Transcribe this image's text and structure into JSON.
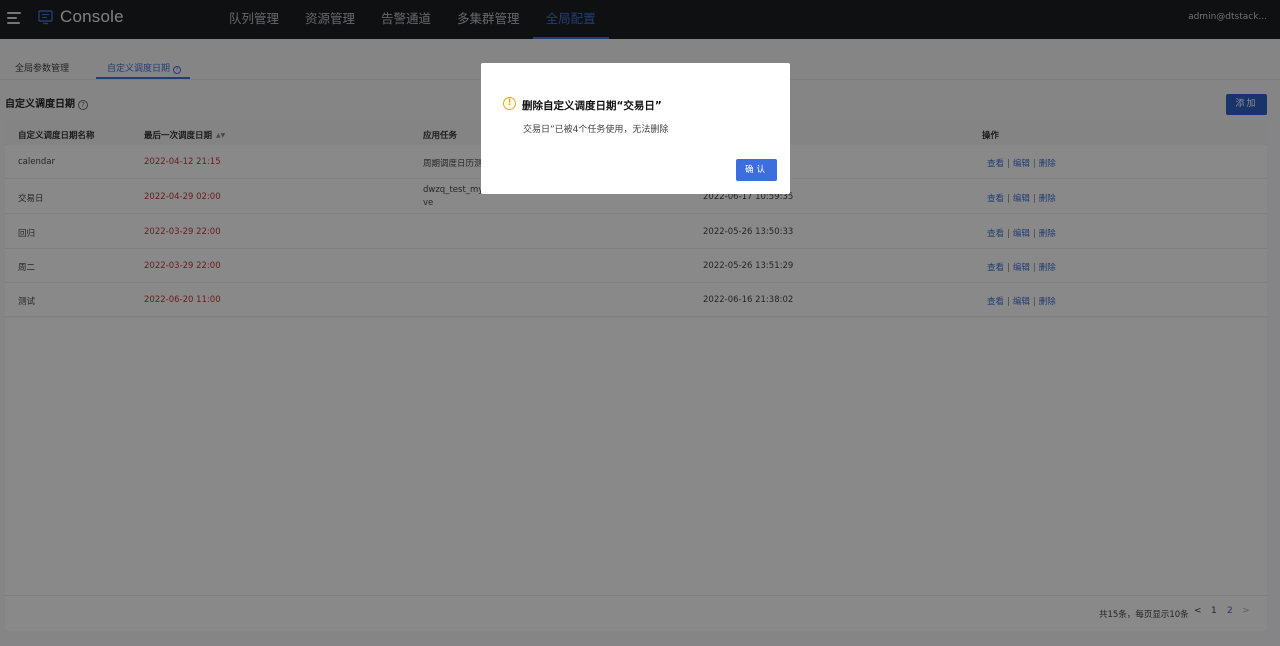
{
  "app": {
    "title": "Console",
    "user": "admin@dtstack..."
  },
  "nav": [
    {
      "label": "队列管理",
      "active": false
    },
    {
      "label": "资源管理",
      "active": false
    },
    {
      "label": "告警通道",
      "active": false
    },
    {
      "label": "多集群管理",
      "active": false
    },
    {
      "label": "全局配置",
      "active": true
    }
  ],
  "subtabs": [
    {
      "label": "全局参数管理"
    },
    {
      "label": "自定义调度日期"
    }
  ],
  "section": {
    "title": "自定义调度日期",
    "add_label": "添加"
  },
  "table": {
    "columns": [
      "自定义调度日期名称",
      "最后一次调度日期",
      "应用任务",
      "",
      "操作"
    ],
    "rows": [
      {
        "name": "calendar",
        "last_date": "2022-04-12 21:15",
        "tasks": "周期调度日历测",
        "updated": "",
        "ops": [
          "查看",
          "编辑",
          "删除"
        ]
      },
      {
        "name": "交易日",
        "last_date": "2022-04-29 02:00",
        "tasks": "dwzq_test_my",
        "tasks_wrap": "ve",
        "updated": "2022-06-17 10:59:35",
        "ops": [
          "查看",
          "编辑",
          "删除"
        ]
      },
      {
        "name": "回归",
        "last_date": "2022-03-29 22:00",
        "tasks": "",
        "updated": "2022-05-26 13:50:33",
        "ops": [
          "查看",
          "编辑",
          "删除"
        ]
      },
      {
        "name": "周二",
        "last_date": "2022-03-29 22:00",
        "tasks": "",
        "updated": "2022-05-26 13:51:29",
        "ops": [
          "查看",
          "编辑",
          "删除"
        ]
      },
      {
        "name": "测试",
        "last_date": "2022-06-20 11:00",
        "tasks": "",
        "updated": "2022-06-16 21:38:02",
        "ops": [
          "查看",
          "编辑",
          "删除"
        ]
      }
    ]
  },
  "pagination": {
    "info": "共15条，每页显示10条",
    "prev": "<",
    "pages": [
      "1",
      "2"
    ],
    "current": "2",
    "next": ">"
  },
  "modal": {
    "title": "删除自定义调度日期“交易日”",
    "message": "交易日”已被4个任务使用，无法删除",
    "confirm_label": "确认",
    "icon": "warning-icon"
  },
  "colors": {
    "accent": "#3f6fd2",
    "date": "#c53434",
    "warning": "#e9a81b"
  }
}
